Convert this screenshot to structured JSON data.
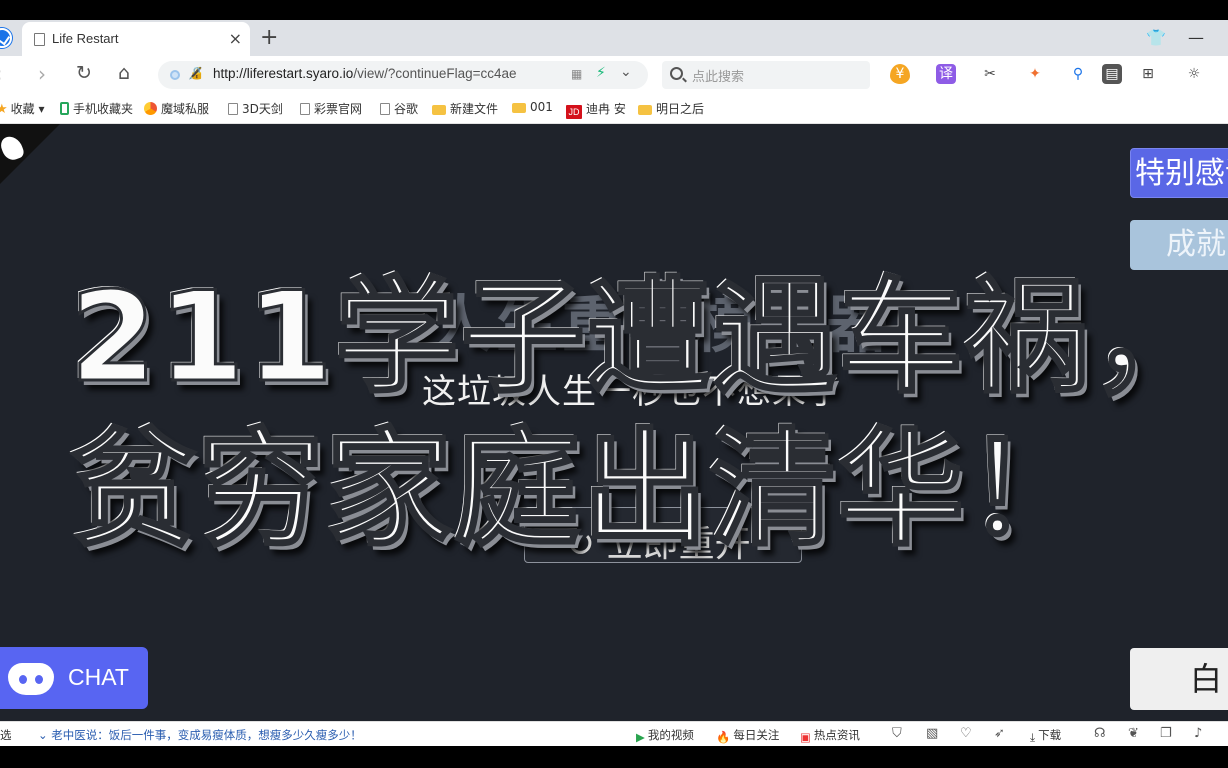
{
  "browser": {
    "tab_title": "Life Restart",
    "tab_close": "×",
    "new_tab": "+",
    "minimize": "—",
    "url_host": "http://liferestart.syaro.io",
    "url_path": "/view/?continueFlag=cc4ae",
    "search_placeholder": "点此搜索"
  },
  "bookmarks": [
    {
      "label": "收藏",
      "icon": "star-icon"
    },
    {
      "label": "手机收藏夹",
      "icon": "phone-icon"
    },
    {
      "label": "魔域私服",
      "icon": "ball-icon"
    },
    {
      "label": "3D天剑",
      "icon": "page-icon"
    },
    {
      "label": "彩票官网",
      "icon": "page-icon"
    },
    {
      "label": "谷歌",
      "icon": "page-icon"
    },
    {
      "label": "新建文件",
      "icon": "folder-icon"
    },
    {
      "label": "001",
      "icon": "folder-icon"
    },
    {
      "label": "迪冉 安",
      "icon": "jd-icon"
    },
    {
      "label": "明日之后",
      "icon": "folder-icon"
    }
  ],
  "jd_badge": "JD",
  "page": {
    "behind_title": "人生重开模拟器",
    "subtitle": "这垃圾人生一秒也不想呆了",
    "restart_label": "↻ 立即重开",
    "special_thanks": "特别感谢",
    "achievements": "成就",
    "white_button": "白",
    "chat_label": "CHAT"
  },
  "caption": {
    "line1": "211学子遭遇车祸，",
    "line2": "贫穷家庭出清华！"
  },
  "statusbar": {
    "left_cut": "选",
    "news": "老中医说：饭后一件事，变成易瘦体质，想瘦多少久瘦多少！",
    "my_videos": "我的视频",
    "daily_follow": "每日关注",
    "hot_news": "热点资讯",
    "download": "下载"
  },
  "colors": {
    "page_bg": "#1f232b",
    "accent_purple": "#5a67e6",
    "discord": "#5865f2",
    "achieve_btn": "#a9c4dc"
  }
}
